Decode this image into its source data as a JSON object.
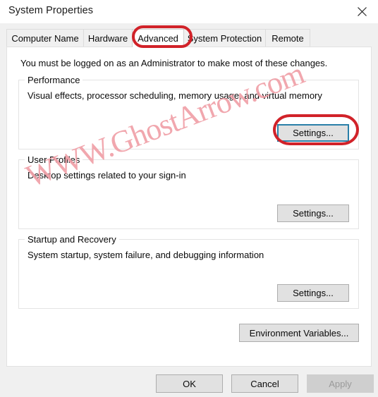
{
  "window": {
    "title": "System Properties",
    "close_icon": "close-icon"
  },
  "tabs": [
    {
      "label": "Computer Name",
      "selected": false
    },
    {
      "label": "Hardware",
      "selected": false
    },
    {
      "label": "Advanced",
      "selected": true
    },
    {
      "label": "System Protection",
      "selected": false
    },
    {
      "label": "Remote",
      "selected": false
    }
  ],
  "content": {
    "intro": "You must be logged on as an Administrator to make most of these changes.",
    "groups": [
      {
        "legend": "Performance",
        "description": "Visual effects, processor scheduling, memory usage, and virtual memory",
        "button_label": "Settings...",
        "focused": true,
        "annotated": true
      },
      {
        "legend": "User Profiles",
        "description": "Desktop settings related to your sign-in",
        "button_label": "Settings...",
        "focused": false,
        "annotated": false
      },
      {
        "legend": "Startup and Recovery",
        "description": "System startup, system failure, and debugging information",
        "button_label": "Settings...",
        "focused": false,
        "annotated": false
      }
    ],
    "environment_variables_label": "Environment Variables..."
  },
  "footer": {
    "ok_label": "OK",
    "cancel_label": "Cancel",
    "apply_label": "Apply",
    "apply_disabled": true
  },
  "watermark": {
    "text": "WWW.GhostArrow.com"
  },
  "colors": {
    "annotation_red": "#d12229",
    "focus_blue": "#2a7fa8",
    "watermark_pink": "#f0a0a8",
    "dialog_bg": "#f0f0f0",
    "panel_bg": "#ffffff"
  }
}
